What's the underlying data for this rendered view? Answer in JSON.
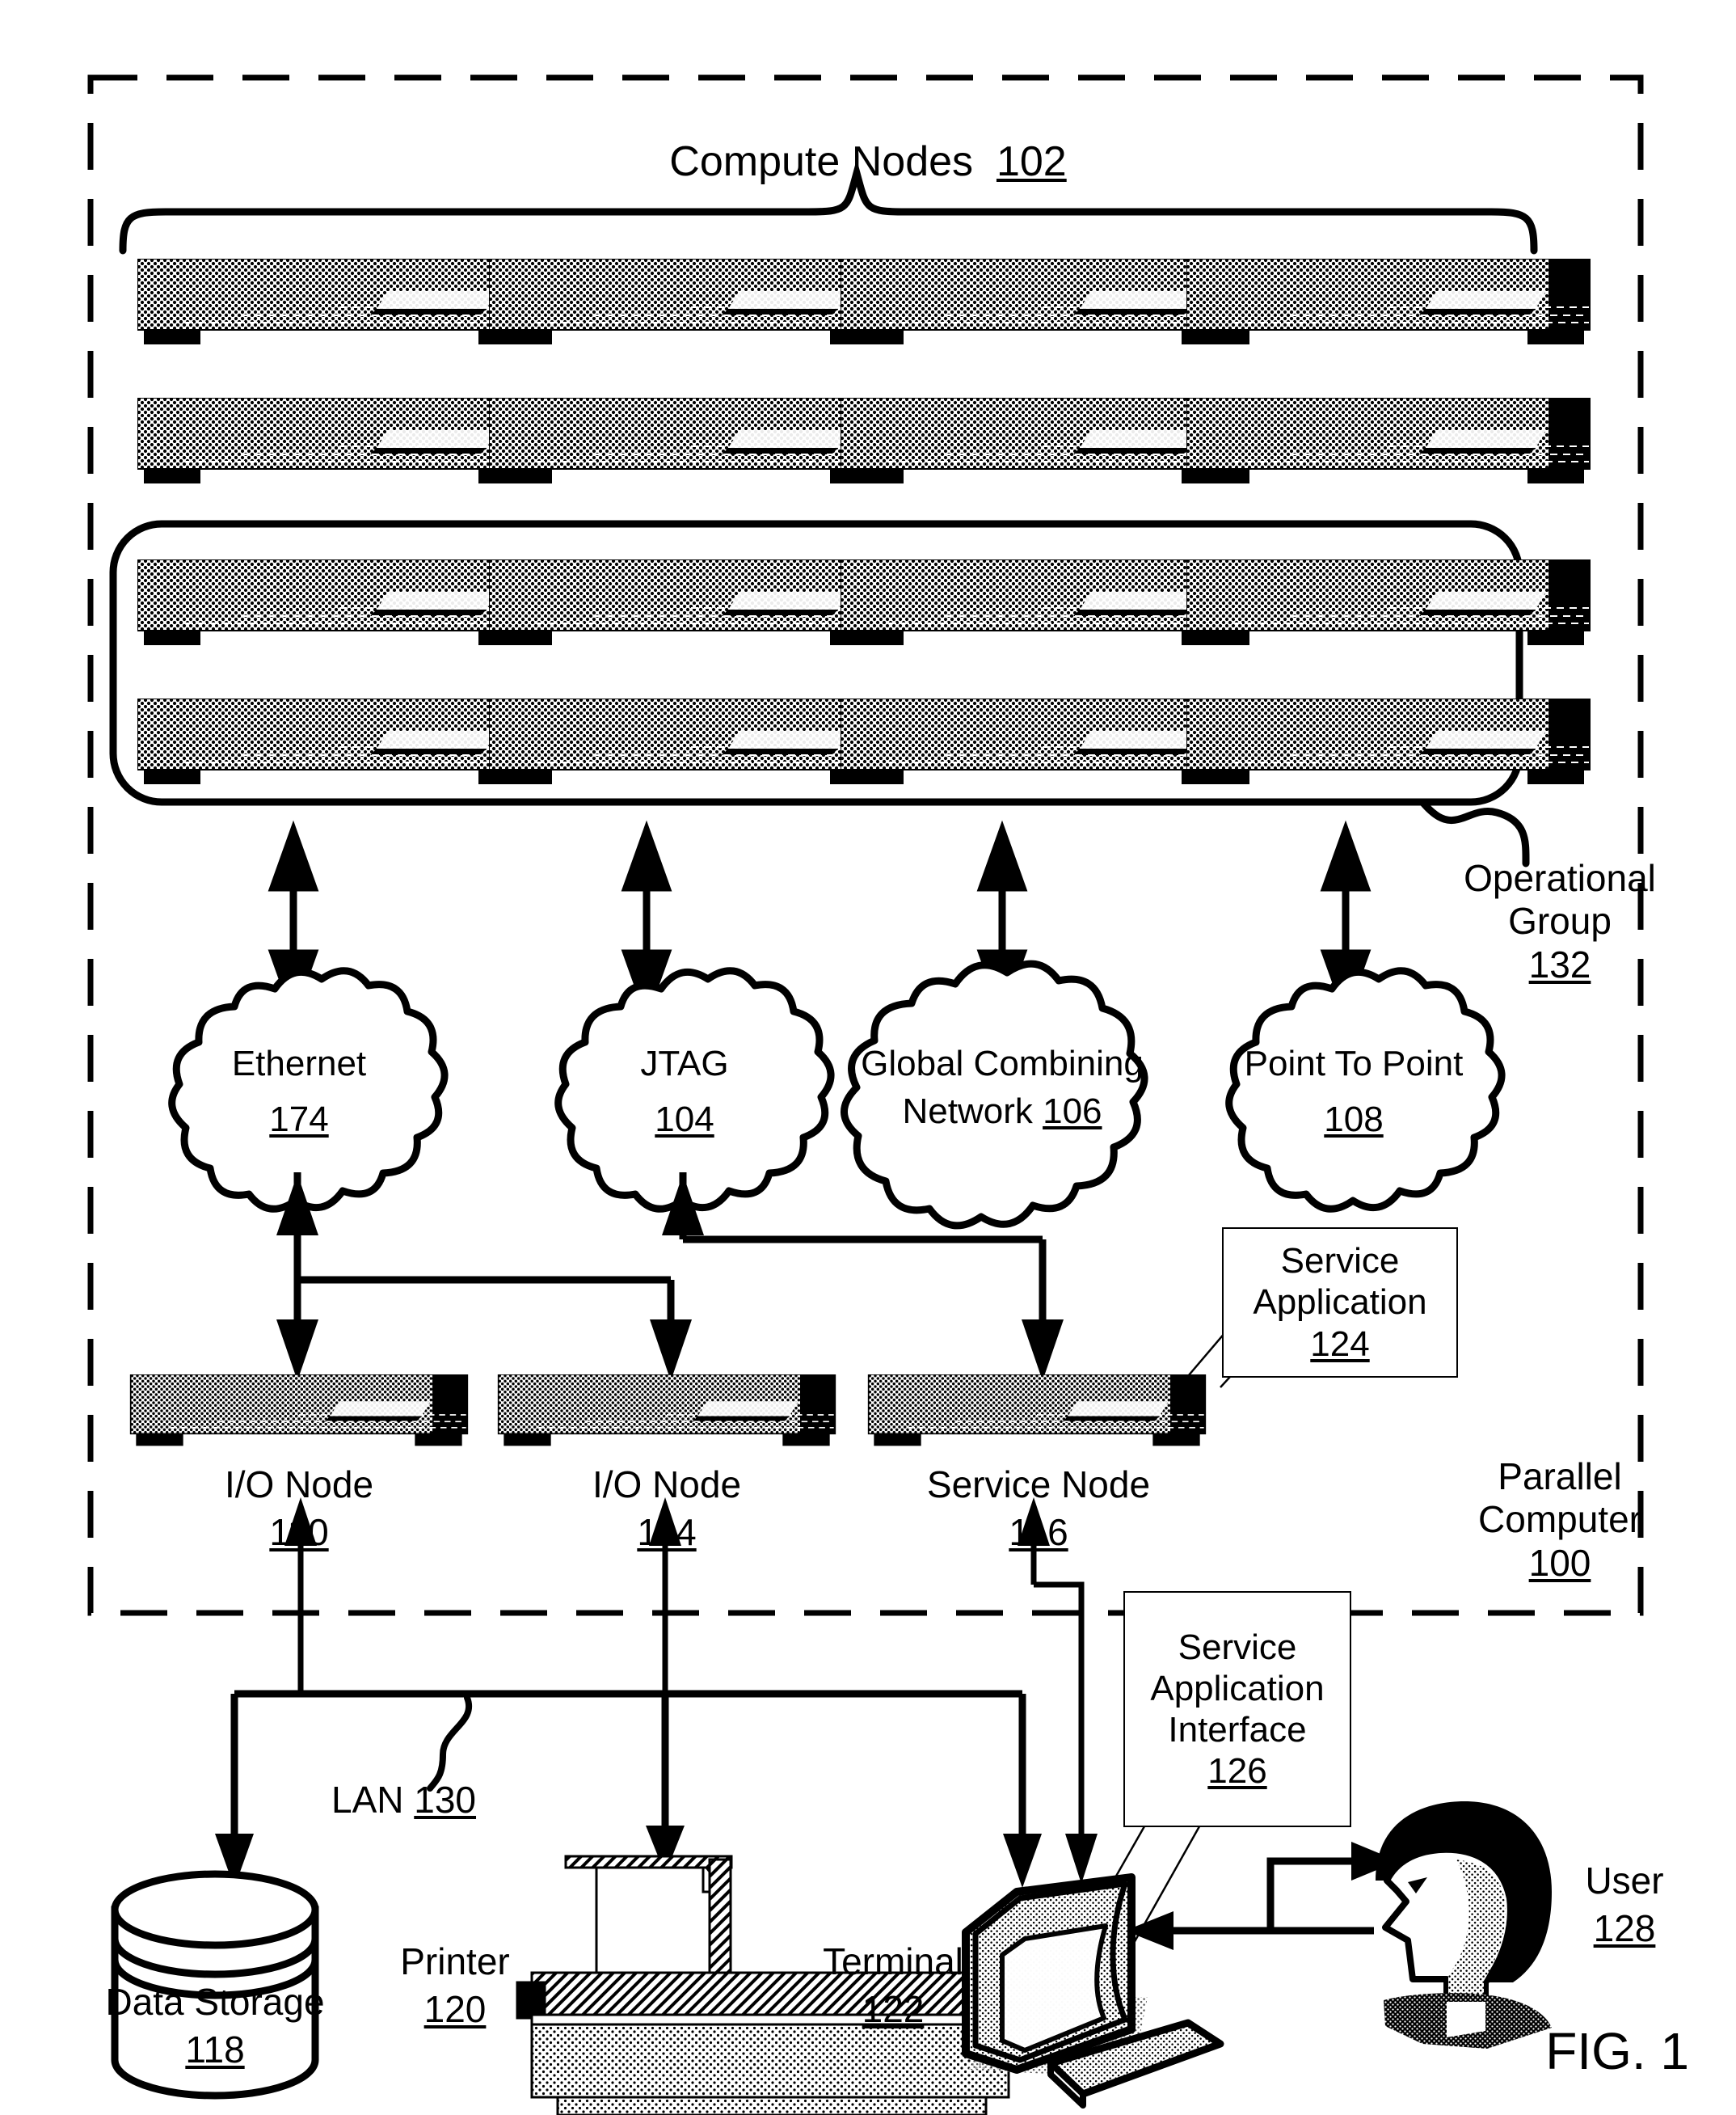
{
  "figure": {
    "caption": "FIG. 1",
    "outer_label_line1": "Parallel",
    "outer_label_line2": "Computer",
    "outer_label_ref": "100"
  },
  "compute_nodes": {
    "title": "Compute Nodes",
    "ref": "102",
    "rows": 4,
    "cols": 4,
    "total": 16,
    "operational_group": {
      "label_line1": "Operational",
      "label_line2": "Group",
      "ref": "132",
      "enclosed_rows": [
        3,
        4
      ]
    }
  },
  "networks": [
    {
      "name": "ethernet",
      "line1": "Ethernet",
      "line2": "",
      "ref": "174"
    },
    {
      "name": "jtag",
      "line1": "JTAG",
      "line2": "",
      "ref": "104"
    },
    {
      "name": "global-combining",
      "line1": "Global Combining",
      "line2": "Network",
      "ref": "106"
    },
    {
      "name": "point-to-point",
      "line1": "Point To Point",
      "line2": "",
      "ref": "108"
    }
  ],
  "service_nodes": [
    {
      "name": "io-node-110",
      "label": "I/O Node",
      "ref": "110"
    },
    {
      "name": "io-node-114",
      "label": "I/O Node",
      "ref": "114"
    },
    {
      "name": "service-node",
      "label": "Service Node",
      "ref": "116"
    }
  ],
  "callouts": {
    "service_application": {
      "line1": "Service",
      "line2": "Application",
      "ref": "124"
    },
    "service_application_interface": {
      "line1": "Service",
      "line2": "Application",
      "line3": "Interface",
      "ref": "126"
    }
  },
  "lan": {
    "label": "LAN",
    "ref": "130"
  },
  "peripherals": [
    {
      "name": "data-storage",
      "label": "Data Storage",
      "ref": "118"
    },
    {
      "name": "printer",
      "label": "Printer",
      "ref": "120"
    },
    {
      "name": "terminal",
      "label": "Terminal",
      "ref": "122"
    },
    {
      "name": "user",
      "label": "User",
      "ref": "128"
    }
  ],
  "colors": {
    "ink": "#000000",
    "paper": "#ffffff"
  }
}
